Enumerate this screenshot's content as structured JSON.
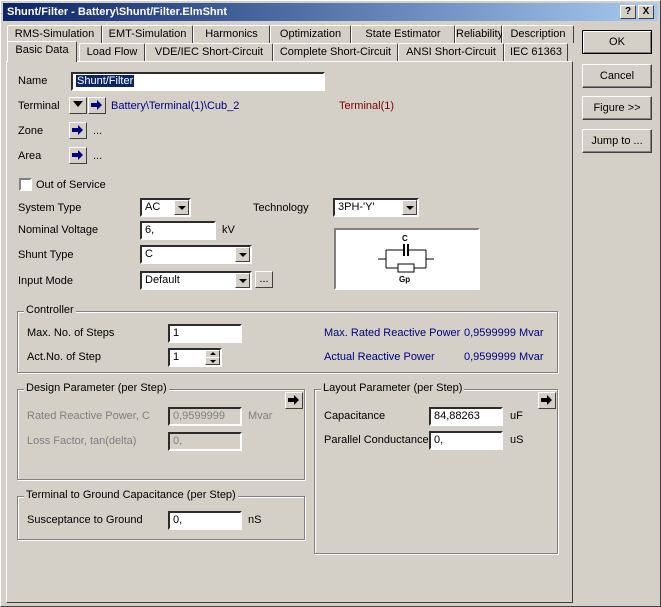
{
  "window": {
    "title": "Shunt/Filter - Battery\\Shunt/Filter.ElmShnt",
    "help_label": "?",
    "close_label": "X"
  },
  "tabs_row1": [
    "RMS-Simulation",
    "EMT-Simulation",
    "Harmonics",
    "Optimization",
    "State Estimator",
    "Reliability",
    "Description"
  ],
  "tabs_row2": [
    "Basic Data",
    "Load Flow",
    "VDE/IEC Short-Circuit",
    "Complete Short-Circuit",
    "ANSI Short-Circuit",
    "IEC 61363"
  ],
  "buttons": {
    "ok": "OK",
    "cancel": "Cancel",
    "figure": "Figure >>",
    "jump": "Jump to ..."
  },
  "basic": {
    "name_label": "Name",
    "name_value": "Shunt/Filter",
    "terminal_label": "Terminal",
    "terminal_value": "Battery\\Terminal(1)\\Cub_2",
    "terminal_ref": "Terminal(1)",
    "zone_label": "Zone",
    "zone_value": "...",
    "area_label": "Area",
    "area_value": "...",
    "out_of_service": "Out of Service",
    "system_type_label": "System Type",
    "system_type_value": "AC",
    "technology_label": "Technology",
    "technology_value": "3PH-'Y'",
    "nominal_voltage_label": "Nominal Voltage",
    "nominal_voltage_value": "6,",
    "nominal_voltage_unit": "kV",
    "shunt_type_label": "Shunt Type",
    "shunt_type_value": "C",
    "input_mode_label": "Input Mode",
    "input_mode_value": "Default",
    "input_mode_button": "...",
    "diagram_c": "C",
    "diagram_gp": "Gp"
  },
  "controller": {
    "title": "Controller",
    "max_steps_label": "Max. No. of Steps",
    "max_steps_value": "1",
    "act_step_label": "Act.No. of Step",
    "act_step_value": "1",
    "max_rated_label": "Max. Rated Reactive Power",
    "max_rated_value": "0,9599999 Mvar",
    "actual_label": "Actual Reactive Power",
    "actual_value": "0,9599999 Mvar"
  },
  "design": {
    "title": "Design Parameter (per Step)",
    "rated_label": "Rated Reactive Power, C",
    "rated_value": "0,9599999",
    "rated_unit": "Mvar",
    "loss_label": "Loss Factor, tan(delta)",
    "loss_value": "0,"
  },
  "layout": {
    "title": "Layout Parameter (per Step)",
    "capacitance_label": "Capacitance",
    "capacitance_value": "84,88263",
    "capacitance_unit": "uF",
    "conductance_label": "Parallel Conductance",
    "conductance_value": "0,",
    "conductance_unit": "uS"
  },
  "ground": {
    "title": "Terminal to Ground Capacitance (per Step)",
    "susceptance_label": "Susceptance to Ground",
    "susceptance_value": "0,",
    "susceptance_unit": "nS"
  }
}
